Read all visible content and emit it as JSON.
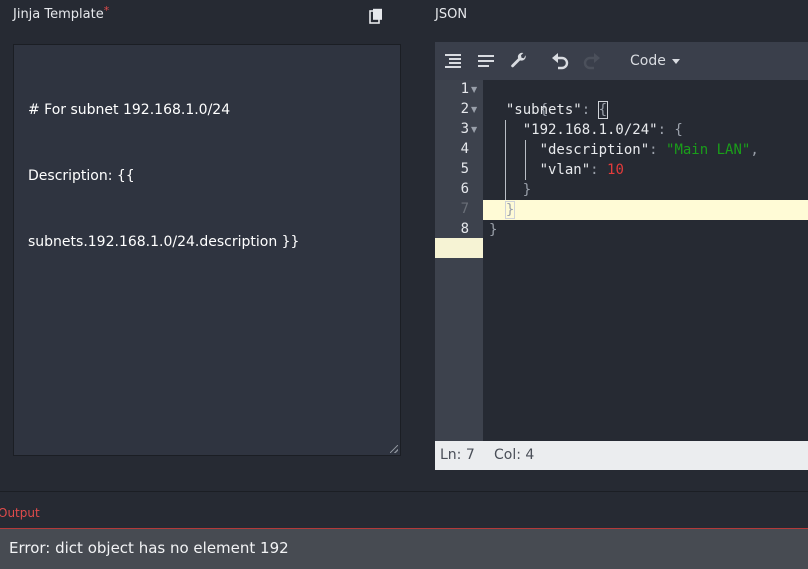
{
  "jinja": {
    "title": "Jinja Template",
    "required_mark": "*",
    "template_lines": [
      "# For subnet 192.168.1.0/24",
      "Description: {{",
      "subnets.192.168.1.0/24.description }}"
    ]
  },
  "json_panel": {
    "title": "JSON",
    "mode_label": "Code",
    "line_numbers": [
      "1",
      "2",
      "3",
      "4",
      "5",
      "6",
      "7",
      "8"
    ],
    "code": {
      "l1_open": "{",
      "l2_key": "\"subnets\"",
      "l2_colon": ": ",
      "l2_brace": "{",
      "l3_key": "\"192.168.1.0/24\"",
      "l3_rest": ": {",
      "l4_key": "\"description\"",
      "l4_colon": ": ",
      "l4_val": "\"Main LAN\"",
      "l4_comma": ",",
      "l5_key": "\"vlan\"",
      "l5_colon": ": ",
      "l5_val": "10",
      "l6_close": "}",
      "l7_close": "}",
      "l8_close": "}"
    },
    "status": {
      "ln": "Ln: 7",
      "col": "Col: 4"
    }
  },
  "output": {
    "label": "Output",
    "message": "Error: dict object has no element 192"
  },
  "icons": [
    "copy-icon",
    "format-icon",
    "compact-icon",
    "repair-icon",
    "undo-icon",
    "redo-icon"
  ],
  "colors": {
    "background": "#262a33",
    "editor_gutter": "#3d424d",
    "active_line": "#fffbd6",
    "string": "#1a9e1a",
    "number": "#e33b3b",
    "error": "#e04b4b"
  }
}
